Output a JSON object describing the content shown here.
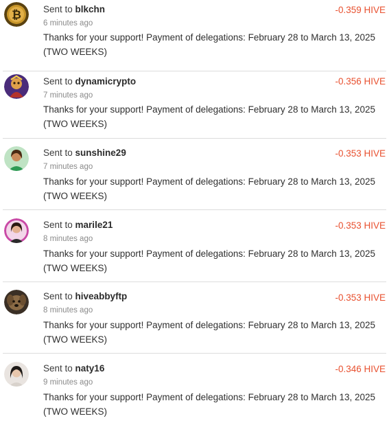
{
  "transfers": [
    {
      "prefix": "Sent to ",
      "user": "blkchn",
      "time": "6 minutes ago",
      "memo": "Thanks for your support! Payment of delegations: February 28 to March 13, 2025 (TWO WEEKS)",
      "amount": "-0.359 HIVE",
      "avatar_icon": "bitcoin-avatar-icon"
    },
    {
      "prefix": "Sent to ",
      "user": "dynamicrypto",
      "time": "7 minutes ago",
      "memo": "Thanks for your support! Payment of delegations: February 28 to March 13, 2025 (TWO WEEKS)",
      "amount": "-0.356 HIVE",
      "avatar_icon": "character-avatar-icon"
    },
    {
      "prefix": "Sent to ",
      "user": "sunshine29",
      "time": "7 minutes ago",
      "memo": "Thanks for your support! Payment of delegations: February 28 to March 13, 2025 (TWO WEEKS)",
      "amount": "-0.353 HIVE",
      "avatar_icon": "person-avatar-icon"
    },
    {
      "prefix": "Sent to ",
      "user": "marile21",
      "time": "8 minutes ago",
      "memo": "Thanks for your support! Payment of delegations: February 28 to March 13, 2025 (TWO WEEKS)",
      "amount": "-0.353 HIVE",
      "avatar_icon": "person-avatar-icon"
    },
    {
      "prefix": "Sent to ",
      "user": "hiveabbyftp",
      "time": "8 minutes ago",
      "memo": "Thanks for your support! Payment of delegations: February 28 to March 13, 2025 (TWO WEEKS)",
      "amount": "-0.353 HIVE",
      "avatar_icon": "dog-avatar-icon"
    },
    {
      "prefix": "Sent to ",
      "user": "naty16",
      "time": "9 minutes ago",
      "memo": "Thanks for your support! Payment of delegations: February 28 to March 13, 2025 (TWO WEEKS)",
      "amount": "-0.346 HIVE",
      "avatar_icon": "person-avatar-icon"
    }
  ],
  "colors": {
    "amount": "#e8502f",
    "divider": "#dcdcdc",
    "time": "#8a8a8a"
  }
}
